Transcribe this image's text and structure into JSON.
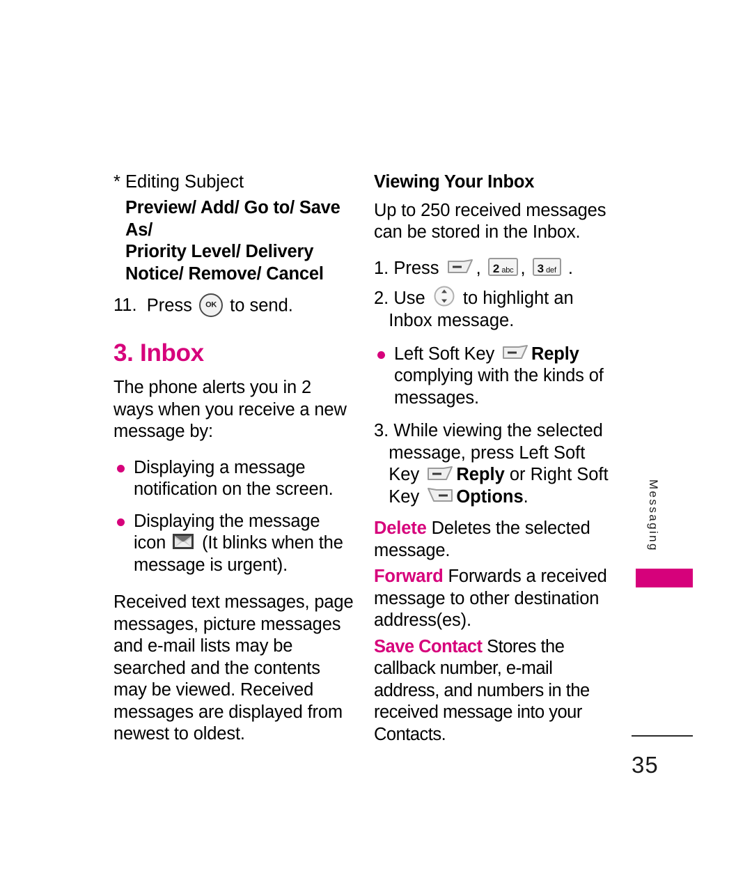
{
  "document": {
    "page_number": "35",
    "side_tab_label": "Messaging",
    "accent_color": "#D6017B"
  },
  "left_column": {
    "editing_subject_heading": "* Editing Subject",
    "menu_chain_lines": [
      "Preview/ Add/ Go to/ Save As/",
      "Priority Level/ Delivery",
      "Notice/ Remove/ Cancel"
    ],
    "step11": {
      "number": "11.",
      "text_before": "Press",
      "icon": "ok-key",
      "icon_label": "OK",
      "text_after": "to send."
    },
    "inbox_heading": "3. Inbox",
    "intro_paragraph": "The phone alerts you in 2 ways when you receive a new message by:",
    "bullets": [
      {
        "text": "Displaying a message notification on the screen."
      },
      {
        "text_before": "Displaying the message icon",
        "icon": "envelope-icon",
        "text_after": "(It blinks when the message is urgent)."
      }
    ],
    "closing_paragraph": "Received text messages, page messages, picture messages and e-mail lists may be searched and the contents may be viewed. Received messages are displayed from newest to oldest."
  },
  "right_column": {
    "viewing_heading": "Viewing Your Inbox",
    "capacity_paragraph": "Up to 250 received messages can be stored in the Inbox.",
    "step1": {
      "number": "1.",
      "text_before": "Press",
      "sep1": ",",
      "sep2": ",",
      "period": ".",
      "keys": [
        {
          "digit": "2",
          "letters": "abc"
        },
        {
          "digit": "3",
          "letters": "def"
        }
      ]
    },
    "step2": {
      "number": "2.",
      "text_before": "Use",
      "icon": "nav-updown-key",
      "text_after": "to highlight an Inbox message."
    },
    "reply_bullet": {
      "label": "Left Soft Key",
      "icon": "left-soft-key",
      "action": "Reply",
      "text_after": "complying with the kinds of messages."
    },
    "step3": {
      "number": "3.",
      "line1": "While viewing the selected",
      "line2": "message, press Left Soft Key",
      "reply_action": "Reply",
      "mid_text": "or Right Soft Key",
      "options_action": "Options",
      "period": "."
    },
    "options": [
      {
        "term": "Delete",
        "desc": "Deletes the selected message."
      },
      {
        "term": "Forward",
        "desc": "Forwards a received message to other destination address(es)."
      },
      {
        "term": "Save Contact",
        "desc": "Stores the callback number, e-mail address, and numbers in  the received message into your Contacts."
      }
    ]
  }
}
